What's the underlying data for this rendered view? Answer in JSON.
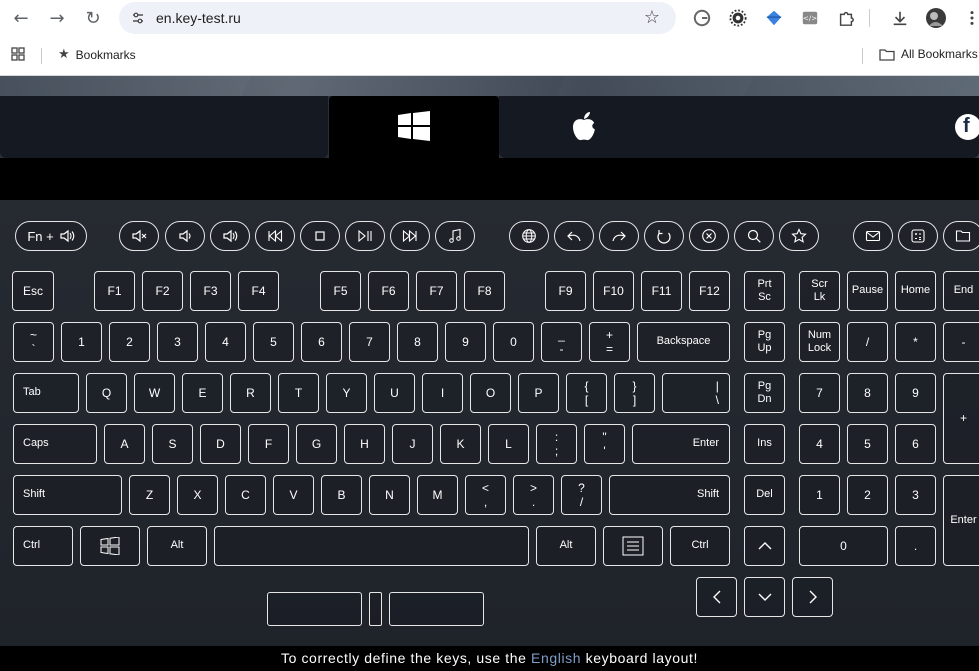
{
  "browser": {
    "url": "en.key-test.ru",
    "bookmarks_label": "Bookmarks",
    "all_bookmarks_label": "All Bookmarks"
  },
  "footer": {
    "prefix": "To correctly define the keys, use the",
    "highlight": "English",
    "suffix": "keyboard layout!"
  },
  "media": {
    "fn_label": "Fn +"
  },
  "keys": {
    "esc": "Esc",
    "f1": "F1",
    "f2": "F2",
    "f3": "F3",
    "f4": "F4",
    "f5": "F5",
    "f6": "F6",
    "f7": "F7",
    "f8": "F8",
    "f9": "F9",
    "f10": "F10",
    "f11": "F11",
    "f12": "F12",
    "prt_sc_1": "Prt",
    "prt_sc_2": "Sc",
    "scr_lk_1": "Scr",
    "scr_lk_2": "Lk",
    "pause": "Pause",
    "home": "Home",
    "end": "End",
    "tilde_top": "~",
    "tilde_bot": "`",
    "n1": "1",
    "n2": "2",
    "n3": "3",
    "n4": "4",
    "n5": "5",
    "n6": "6",
    "n7": "7",
    "n8": "8",
    "n9": "9",
    "n0": "0",
    "minus_top": "_",
    "minus_bot": "-",
    "plus_top": "+",
    "plus_bot": "=",
    "backspace": "Backspace",
    "pgup_1": "Pg",
    "pgup_2": "Up",
    "numlock_1": "Num",
    "numlock_2": "Lock",
    "np_div": "/",
    "np_mul": "*",
    "np_minus": "-",
    "tab": "Tab",
    "q": "Q",
    "w": "W",
    "e": "E",
    "r": "R",
    "t": "T",
    "y": "Y",
    "u": "U",
    "i": "I",
    "o": "O",
    "p": "P",
    "lbr_top": "{",
    "lbr_bot": "[",
    "rbr_top": "}",
    "rbr_bot": "]",
    "bs_top": "|",
    "bs_bot": "\\",
    "pgdn_1": "Pg",
    "pgdn_2": "Dn",
    "np7": "7",
    "np8": "8",
    "np9": "9",
    "np_plus": "+",
    "caps": "Caps",
    "a": "A",
    "s": "S",
    "d": "D",
    "f": "F",
    "g": "G",
    "h": "H",
    "j": "J",
    "k": "K",
    "l": "L",
    "semi_top": ":",
    "semi_bot": ";",
    "quote_top": "\"",
    "quote_bot": "'",
    "enter": "Enter",
    "ins": "Ins",
    "np4": "4",
    "np5": "5",
    "np6": "6",
    "shift": "Shift",
    "z": "Z",
    "x": "X",
    "c": "C",
    "v": "V",
    "b": "B",
    "n": "N",
    "m": "M",
    "lt_top": "<",
    "lt_bot": ",",
    "gt_top": ">",
    "gt_bot": ".",
    "q_top": "?",
    "q_bot": "/",
    "shift_r": "Shift",
    "del": "Del",
    "np1": "1",
    "np2": "2",
    "np3": "3",
    "np_enter": "Enter",
    "ctrl": "Ctrl",
    "alt": "Alt",
    "alt_r": "Alt",
    "ctrl_r": "Ctrl",
    "np0": "0",
    "np_dot": "."
  }
}
